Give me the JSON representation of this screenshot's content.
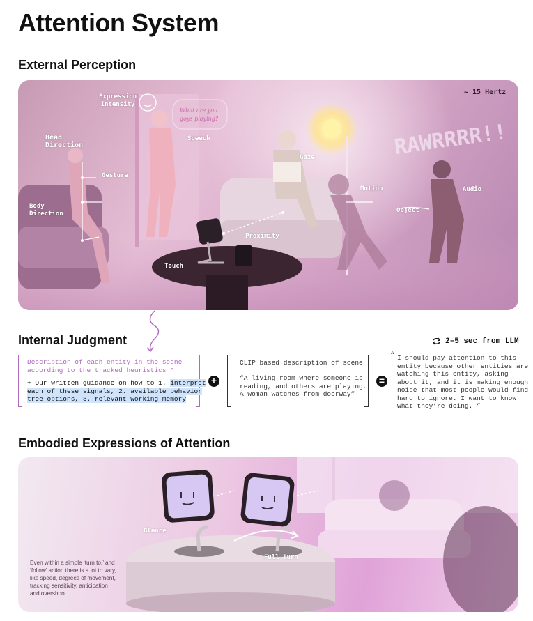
{
  "page_title": "Attention System",
  "sections": {
    "external": "External Perception",
    "internal": "Internal Judgment",
    "embodied": "Embodied Expressions of Attention"
  },
  "perception": {
    "rate": "~ 15 Hertz",
    "labels": {
      "expression": "Expression\nIntensity",
      "head_direction": "Head\nDirection",
      "speech": "Speech",
      "gesture": "Gesture",
      "gaze": "Gaze",
      "motion": "Motion",
      "audio": "Audio",
      "object": "Object",
      "body_direction": "Body\nDirection",
      "proximity": "Proximity",
      "touch": "Touch"
    },
    "speech_bubble": "What are you\ngoys playing?",
    "audio_text": "RAWRRRR!!"
  },
  "judgment": {
    "timing": "2–5 sec from LLM",
    "box1_line1": "Description of each entity in the scene\naccording to the tracked heuristics ^",
    "box1_plain": "+ Our written guidance on how to 1. ",
    "box1_highlight": "interpret\neach of these signals, 2. available behavior\ntree options, 3. relevant working memory",
    "plus": "+",
    "box2_line1": "CLIP based description of scene",
    "box2_quote": "“A living room where someone is\nreading, and others are playing.\nA woman watches from doorway”",
    "equals": "=",
    "output_quote_mark": "“",
    "output": "I should pay attention to this\nentity because other entities are\nwatching this entity, asking\nabout it, and it is making enough\nnoise that most people would find\nhard to ignore. I want to know\nwhat they’re doing. ”"
  },
  "embodied": {
    "glance": "Glance",
    "full_turn": "Full Turn",
    "caption": "Even within a simple ‘turn to,’ and\n‘follow’ action there is a lot to vary,\nlike speed, degrees of movement,\ntracking sensitivity, anticipation\nand overshoot"
  },
  "colors": {
    "accent_purple": "#b06bbf",
    "highlight_blue": "#cfe3fb",
    "label_white": "#ffffff"
  }
}
